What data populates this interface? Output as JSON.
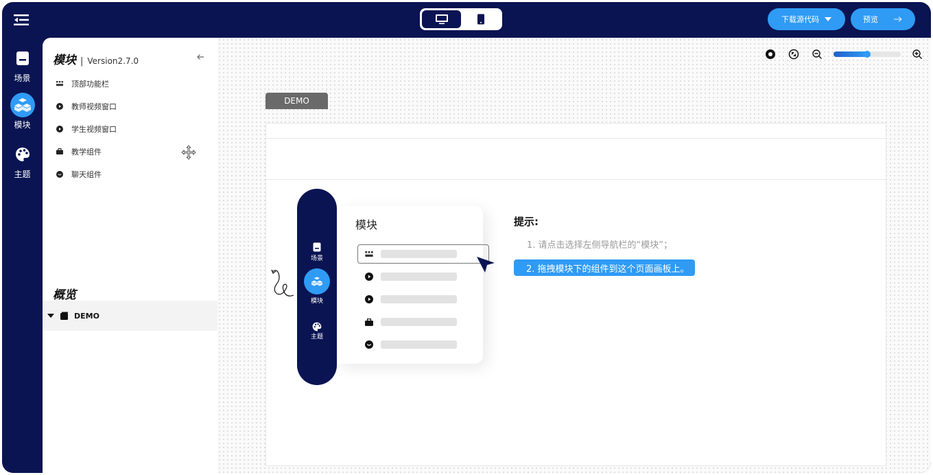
{
  "topbar": {
    "device_options": [
      "desktop",
      "mobile"
    ],
    "active_device": "desktop",
    "download_label": "下载源代码",
    "preview_label": "预览",
    "accent": "#2f9bf5",
    "navy": "#0a1452"
  },
  "rail": {
    "items": [
      {
        "label": "场景",
        "icon": "scene-icon"
      },
      {
        "label": "模块",
        "icon": "cubes-icon",
        "active": true
      },
      {
        "label": "主题",
        "icon": "palette-icon"
      }
    ]
  },
  "panel": {
    "title": "模块",
    "separator": "|",
    "version": "Version2.7.0",
    "modules": [
      {
        "label": "顶部功能栏",
        "icon": "grid-icon"
      },
      {
        "label": "教师视频窗口",
        "icon": "play-icon"
      },
      {
        "label": "学生视频窗口",
        "icon": "play-icon"
      },
      {
        "label": "教学组件",
        "icon": "briefcase-icon"
      },
      {
        "label": "聊天组件",
        "icon": "chat-icon"
      }
    ],
    "overview_title": "概览",
    "tree": [
      {
        "label": "DEMO",
        "expanded": true
      }
    ]
  },
  "canvas": {
    "zoom_fraction": 0.5,
    "demo_tab": "DEMO",
    "illustration": {
      "rail": [
        {
          "label": "场景"
        },
        {
          "label": "模块",
          "active": true
        },
        {
          "label": "主题"
        }
      ],
      "card_title": "模块",
      "rows": 5
    },
    "tips": {
      "title": "提示:",
      "step1": "1. 请点击选择左侧导航栏的“模块”；",
      "step2": "2. 拖拽模块下的组件到这个页面画板上。"
    }
  }
}
